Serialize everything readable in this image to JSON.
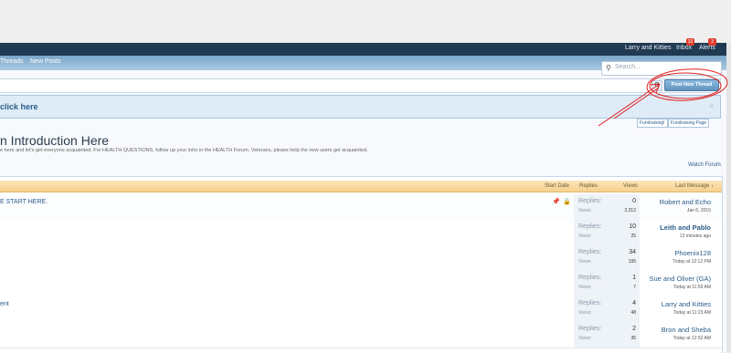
{
  "topbar": {
    "user": "Larry and Kitties",
    "inbox": "Inbox",
    "inbox_count": "33",
    "alerts": "Alerts",
    "alerts_count": "3"
  },
  "nav": {
    "link1": "Threads",
    "link2": "New Posts"
  },
  "search": {
    "placeholder": "Search..."
  },
  "toolbar": {
    "post_label": "Post New Thread"
  },
  "notice": {
    "text": "click here",
    "close": "×"
  },
  "fundraising": {
    "btn1": "Fundraising!",
    "btn2": "Fundraising Page"
  },
  "forum": {
    "title": "n Introduction Here",
    "description": "e here and let's get everyone acquainted. For HEALTH QUESTIONS, follow up your intro in the HEALTH Forum. Veterans, please help the new users get acquainted.",
    "watch": "Watch Forum"
  },
  "table": {
    "headers": {
      "start_date": "Start Date",
      "replies": "Replies",
      "views": "Views",
      "last_message": "Last Message ↓"
    },
    "reply_label": "Replies:",
    "view_label": "Views:",
    "rows": [
      {
        "title": "E START HERE.",
        "replies": "0",
        "views": "2,312",
        "last_user": "Robert and Echo",
        "last_date": "Jan 6, 2015"
      },
      {
        "title": "",
        "replies": "10",
        "views": "25",
        "last_user": "Leith and Pablo",
        "last_date": "12 minutes ago"
      },
      {
        "title": "",
        "replies": "34",
        "views": "195",
        "last_user": "Phoenix128",
        "last_date": "Today at 12:12 PM"
      },
      {
        "title": "",
        "replies": "1",
        "views": "7",
        "last_user": "Sue and Oliver (GA)",
        "last_date": "Today at 11:59 AM"
      },
      {
        "title": "ent",
        "replies": "4",
        "views": "48",
        "last_user": "Larry and Kitties",
        "last_date": "Today at 11:23 AM"
      },
      {
        "title": "",
        "replies": "2",
        "views": "35",
        "last_user": "Bron and Sheba",
        "last_date": "Today at 12:52 AM"
      }
    ]
  },
  "colors": {
    "accent": "#2b5d8a",
    "annotation": "#e02020"
  }
}
